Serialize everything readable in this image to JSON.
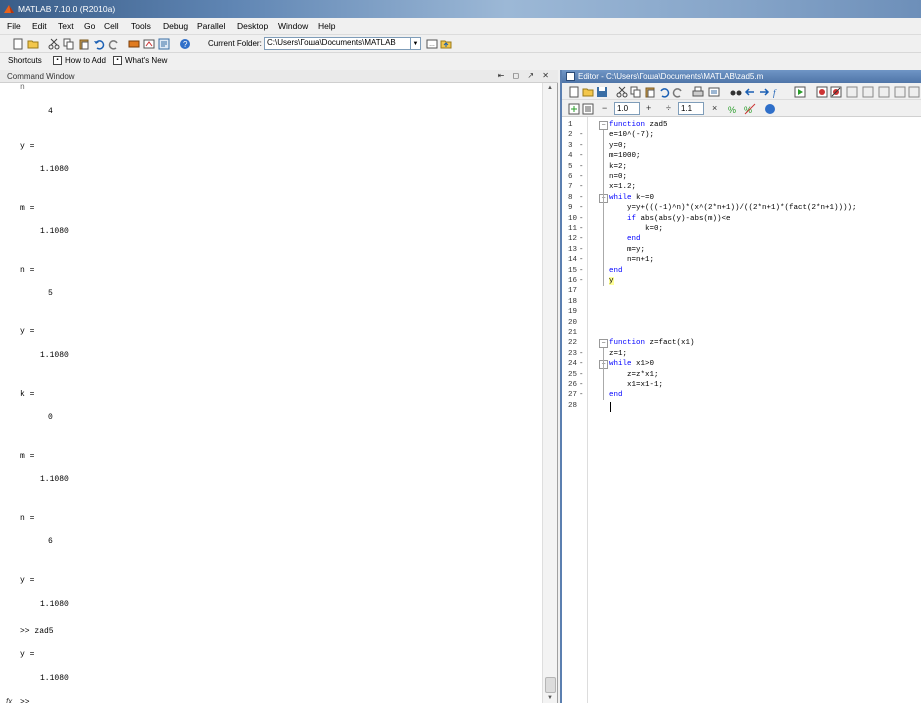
{
  "app": {
    "title": "MATLAB  7.10.0 (R2010a)",
    "menus": [
      "File",
      "Edit",
      "Text",
      "Go",
      "Cell",
      "Tools",
      "Debug",
      "Parallel",
      "Desktop",
      "Window",
      "Help"
    ],
    "toolbar": {
      "current_folder_label": "Current Folder:",
      "current_folder_value": "C:\\Users\\Гоша\\Documents\\MATLAB"
    },
    "shortcuts": [
      "Shortcuts",
      "How to Add",
      "What's New"
    ]
  },
  "command_window": {
    "title": "Command Window",
    "controls": "⇤ ◻ ↗ ✕",
    "lines": [
      "4",
      "y =",
      "1.1080",
      "m =",
      "1.1080",
      "n =",
      "5",
      "y =",
      "1.1080",
      "k =",
      "0",
      "m =",
      "1.1080",
      "n =",
      "6",
      "y =",
      "1.1080",
      ">> zad5",
      "y =",
      "1.1080"
    ],
    "prompt": ">>",
    "fx_label": "fx"
  },
  "editor": {
    "title": "Editor - C:\\Users\\Гоша\\Documents\\MATLAB\\zad5.m",
    "cell_toolbar": {
      "value_a": "1.0",
      "value_b": "1.1",
      "minus": "−",
      "plus": "+",
      "divide": "÷",
      "times": "×"
    },
    "code_lines": [
      {
        "n": "1",
        "dash": "",
        "text": "function zad5"
      },
      {
        "n": "2",
        "dash": "-",
        "text": "e=10^(-7);"
      },
      {
        "n": "3",
        "dash": "-",
        "text": "y=0;"
      },
      {
        "n": "4",
        "dash": "-",
        "text": "m=1000;"
      },
      {
        "n": "5",
        "dash": "-",
        "text": "k=2;"
      },
      {
        "n": "6",
        "dash": "-",
        "text": "n=0;"
      },
      {
        "n": "7",
        "dash": "-",
        "text": "x=1.2;"
      },
      {
        "n": "8",
        "dash": "-",
        "text": "while k~=0"
      },
      {
        "n": "9",
        "dash": "-",
        "text": "    y=y+(((-1)^n)*(x^(2*n+1))/((2*n+1)*(fact(2*n+1))));"
      },
      {
        "n": "10",
        "dash": "-",
        "text": "    if abs(abs(y)-abs(m))<e"
      },
      {
        "n": "11",
        "dash": "-",
        "text": "        k=0;"
      },
      {
        "n": "12",
        "dash": "-",
        "text": "    end"
      },
      {
        "n": "13",
        "dash": "-",
        "text": "    m=y;"
      },
      {
        "n": "14",
        "dash": "-",
        "text": "    n=n+1;"
      },
      {
        "n": "15",
        "dash": "-",
        "text": "end"
      },
      {
        "n": "16",
        "dash": "-",
        "text": "y"
      },
      {
        "n": "17",
        "dash": "",
        "text": ""
      },
      {
        "n": "18",
        "dash": "",
        "text": ""
      },
      {
        "n": "19",
        "dash": "",
        "text": ""
      },
      {
        "n": "20",
        "dash": "",
        "text": ""
      },
      {
        "n": "21",
        "dash": "",
        "text": ""
      },
      {
        "n": "22",
        "dash": "",
        "text": "function z=fact(x1)"
      },
      {
        "n": "23",
        "dash": "-",
        "text": "z=1;"
      },
      {
        "n": "24",
        "dash": "-",
        "text": "while x1>0"
      },
      {
        "n": "25",
        "dash": "-",
        "text": "    z=z*x1;"
      },
      {
        "n": "26",
        "dash": "-",
        "text": "    x1=x1-1;"
      },
      {
        "n": "27",
        "dash": "-",
        "text": "end"
      },
      {
        "n": "28",
        "dash": "",
        "text": ""
      }
    ]
  },
  "colors": {
    "keyword": "#0000ff",
    "editor_border": "#5b7fb0"
  }
}
